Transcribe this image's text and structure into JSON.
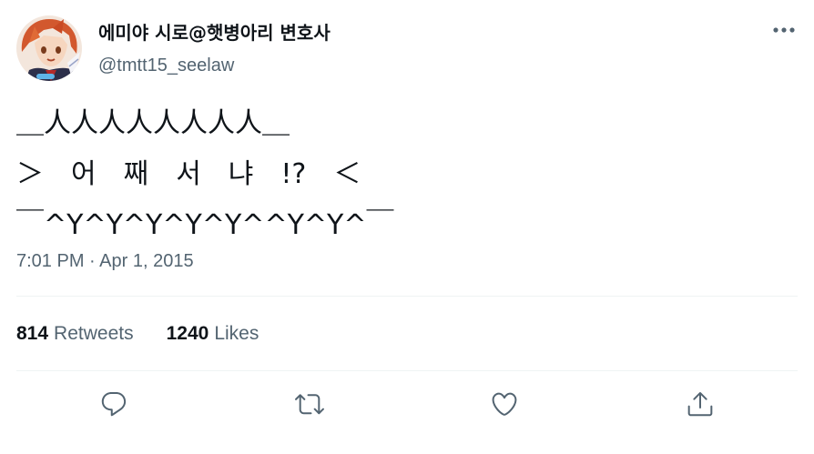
{
  "author": {
    "display_name": "에미야 시로@햇병아리 변호사",
    "handle": "@tmtt15_seelaw",
    "avatar_icon": "avatar-image"
  },
  "more_icon": "more-horizontal-icon",
  "tweet": {
    "lines": [
      "＿人人人人人人人人＿",
      "＞　어　째　서　냐　!?　＜",
      "￣^Y^Y^Y^Y^Y^^Y^Y^￣"
    ],
    "timestamp": "7:01 PM · Apr 1, 2015"
  },
  "stats": {
    "retweets_count": "814",
    "retweets_label": "Retweets",
    "likes_count": "1240",
    "likes_label": "Likes"
  },
  "actions": [
    {
      "name": "reply",
      "icon": "reply-icon"
    },
    {
      "name": "retweet",
      "icon": "retweet-icon"
    },
    {
      "name": "like",
      "icon": "heart-icon"
    },
    {
      "name": "share",
      "icon": "share-icon"
    }
  ],
  "colors": {
    "text_primary": "#0f1419",
    "text_secondary": "#536471",
    "divider": "#eff3f4",
    "icon": "#536471"
  }
}
